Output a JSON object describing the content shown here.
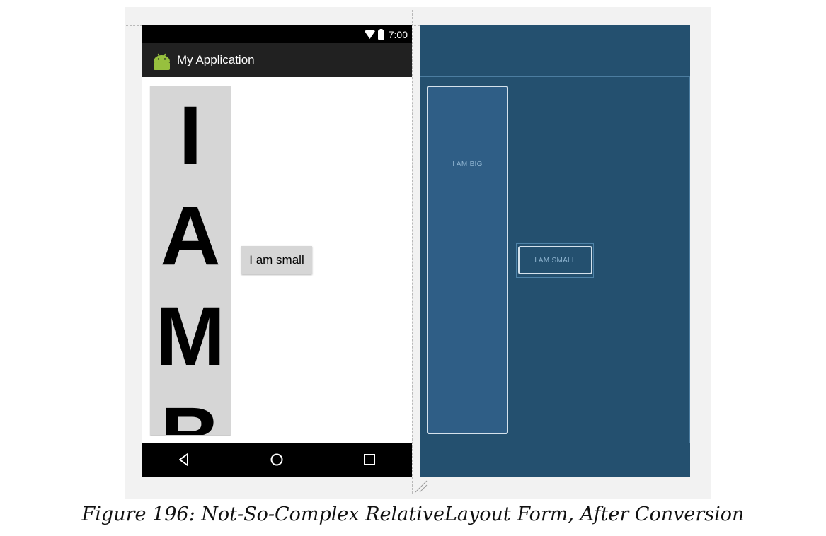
{
  "phone": {
    "status_bar": {
      "time": "7:00"
    },
    "app_bar": {
      "title": "My Application"
    },
    "big_button_label": "I AM B",
    "small_button_label": "I am small"
  },
  "blueprint": {
    "big_label": "I AM BIG",
    "small_label": "I AM SMALL"
  },
  "caption": "Figure 196: Not-So-Complex RelativeLayout Form, After Conversion",
  "colors": {
    "blueprint_bg": "#24506f",
    "blueprint_widget": "#2f5e86",
    "android_green": "#97c03e",
    "button_gray": "#d6d6d6"
  }
}
